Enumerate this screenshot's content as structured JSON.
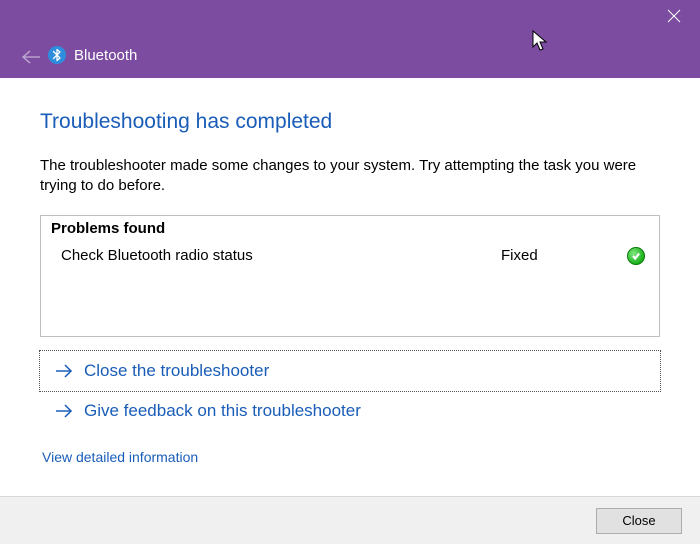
{
  "titlebar": {
    "title": "Bluetooth"
  },
  "main": {
    "heading": "Troubleshooting has completed",
    "description": "The troubleshooter made some changes to your system. Try attempting the task you were trying to do before."
  },
  "problems": {
    "header": "Problems found",
    "items": [
      {
        "name": "Check Bluetooth radio status",
        "status": "Fixed",
        "icon": "fixed-check"
      }
    ]
  },
  "actions": {
    "close_troubleshooter": "Close the troubleshooter",
    "give_feedback": "Give feedback on this troubleshooter",
    "view_detail": "View detailed information"
  },
  "footer": {
    "close_label": "Close"
  }
}
